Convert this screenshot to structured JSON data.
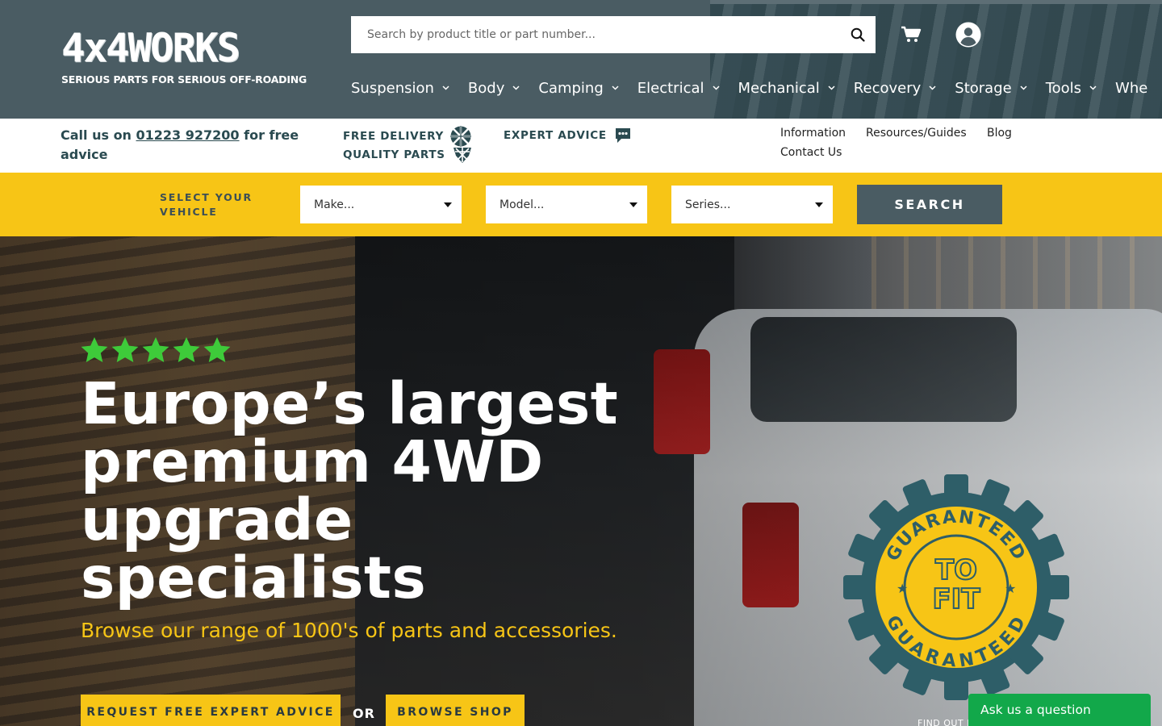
{
  "brand": {
    "logo_text": "4x4WORKS",
    "tagline": "SERIOUS PARTS FOR SERIOUS OFF-ROADING"
  },
  "search": {
    "placeholder": "Search by product title or part number..."
  },
  "nav": [
    {
      "label": "Suspension"
    },
    {
      "label": "Body"
    },
    {
      "label": "Camping"
    },
    {
      "label": "Electrical"
    },
    {
      "label": "Mechanical"
    },
    {
      "label": "Recovery"
    },
    {
      "label": "Storage"
    },
    {
      "label": "Tools"
    },
    {
      "label": "Whe"
    }
  ],
  "infobar": {
    "call_prefix": "Call us on ",
    "phone": "01223 927200",
    "call_suffix": " for free advice",
    "usp_delivery": "FREE DELIVERY",
    "usp_quality": "QUALITY PARTS",
    "usp_advice": "EXPERT ADVICE",
    "links": [
      "Information",
      "Resources/Guides",
      "Blog",
      "Contact Us"
    ]
  },
  "vehicle": {
    "label_line1": "SELECT YOUR",
    "label_line2": "VEHICLE",
    "make": "Make...",
    "model": "Model...",
    "series": "Series...",
    "search_label": "SEARCH"
  },
  "hero": {
    "rating": 5,
    "title": "Europe’s largest premium 4WD upgrade specialists",
    "subtitle": "Browse our range of 1000's of parts and accessories.",
    "cta_advice": "REQUEST FREE EXPERT ADVICE",
    "or": "OR",
    "cta_shop": "BROWSE SHOP",
    "find_out": "FIND OUT M"
  },
  "badge": {
    "ring_text": "GUARANTEED · GUARANTEED",
    "center_line1": "TO",
    "center_line2": "FIT"
  },
  "chat": {
    "label": "Ask us a question"
  },
  "colors": {
    "header_bg": "#4a5c63",
    "accent_yellow": "#f7c516",
    "teal_text": "#2a4a50",
    "chat_green": "#12a84a",
    "star_green": "#3ecb3a"
  }
}
